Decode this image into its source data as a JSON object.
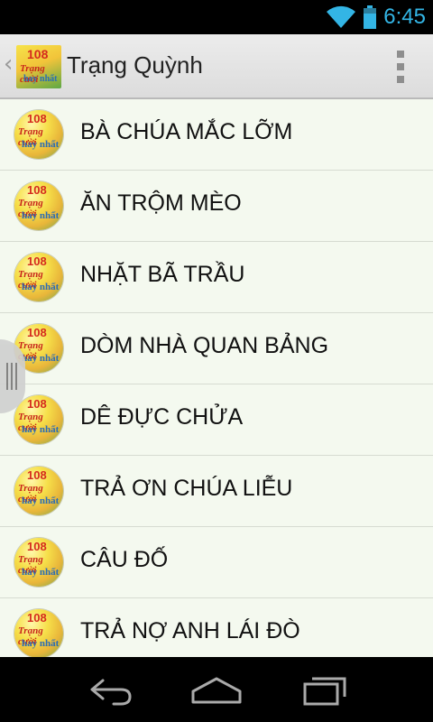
{
  "status_bar": {
    "time": "6:45",
    "accent": "#33b5e5"
  },
  "action_bar": {
    "title": "Trạng Quỳnh",
    "up_icon": "chevron-left-icon",
    "logo_text": {
      "number": "108",
      "line1": "Trạng cười",
      "line2": "hay nhất"
    },
    "overflow_icon": "overflow-menu-icon"
  },
  "list": {
    "items": [
      {
        "label": "BÀ CHÚA MẮC LỠM"
      },
      {
        "label": "ĂN TRỘM MÈO"
      },
      {
        "label": "NHẶT BÃ TRẦU"
      },
      {
        "label": "DÒM NHÀ QUAN BẢNG"
      },
      {
        "label": "DÊ ĐỰC CHỬA"
      },
      {
        "label": "TRẢ ƠN CHÚA LIỄU"
      },
      {
        "label": "CÂU ĐỐ"
      },
      {
        "label": "TRẢ NỢ ANH LÁI ĐÒ"
      }
    ],
    "background": "#f4f9ef"
  },
  "nav_bar": {
    "back_icon": "back-icon",
    "home_icon": "home-icon",
    "recents_icon": "recent-apps-icon"
  }
}
